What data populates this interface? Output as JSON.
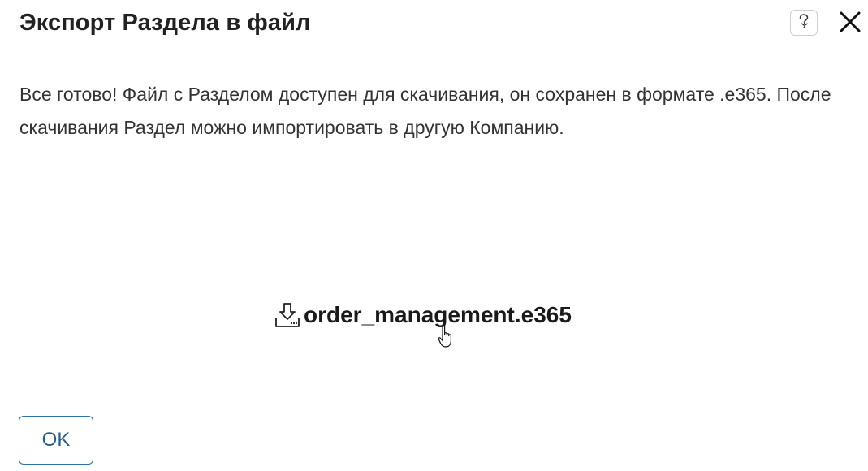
{
  "dialog": {
    "title": "Экспорт Раздела в файл",
    "message": "Все готово! Файл с Разделом доступен для скачивания, он сохранен в формате .e365. После скачивания Раздел можно импортировать в другую Компанию.",
    "file_name": "order_management.e365",
    "ok_label": "OK",
    "help_icon": "question-icon",
    "close_icon": "close-icon",
    "download_icon": "download-icon"
  },
  "colors": {
    "accent": "#2f6fa6",
    "text": "#222222",
    "border": "#cfcfcf"
  }
}
